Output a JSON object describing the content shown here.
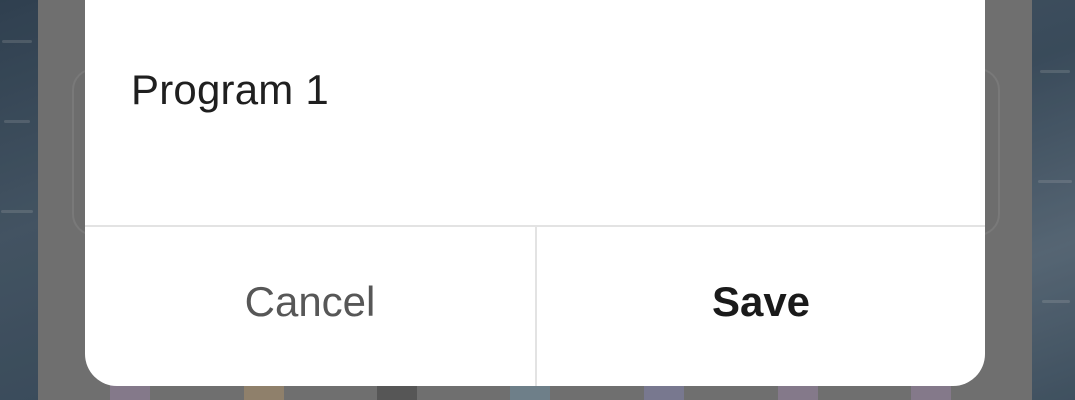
{
  "dialog": {
    "field_value": "Program 1",
    "cancel_label": "Cancel",
    "save_label": "Save"
  },
  "colors": {
    "dialog_background": "#ffffff",
    "divider": "#e3e3e3",
    "cancel_text": "#575757",
    "save_text": "#1a1a1a",
    "swatches": [
      "#a99bb1",
      "#b8a48a",
      "#6f6f6f",
      "#8ea3b0",
      "#9a9ab8",
      "#a99bb1",
      "#a99bb1"
    ]
  }
}
